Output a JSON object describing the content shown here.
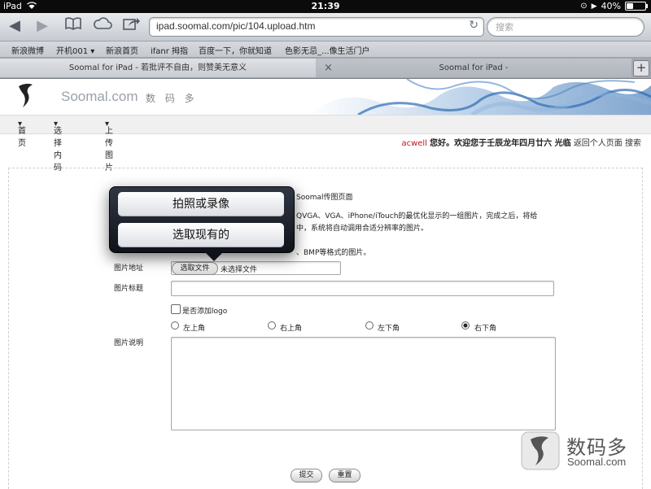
{
  "status_bar": {
    "device": "iPad",
    "time": "21:39",
    "battery": "40%",
    "battery_level": 0.4
  },
  "browser": {
    "url": "ipad.soomal.com/pic/104.upload.htm",
    "search_placeholder": "搜索",
    "bookmarks": [
      "新浪微博",
      "开机001 ▾",
      "新浪首页",
      "ifanr 拇指",
      "百度一下，你就知道",
      "色影无忌_...像生活门户"
    ],
    "tabs": [
      {
        "title": "Soomal for iPad - 若批评不自由，则赞美无意义"
      },
      {
        "title": "Soomal for iPad -"
      }
    ],
    "new_tab": "+",
    "close_tab": "×"
  },
  "site": {
    "brand": "Soomal.com",
    "brand_cn": "数 码 多",
    "nav": [
      {
        "label": "首页"
      },
      {
        "label": "选择内码"
      },
      {
        "label": "上传图片"
      }
    ],
    "welcome": {
      "user": "acwell",
      "message": "您好。欢迎您于壬辰龙年四月廿六 光临",
      "links": "返回个人页面 搜索"
    }
  },
  "form": {
    "intro_title": "Soomal传图页面",
    "intro_line1": "QVGA、VGA、iPhone/iTouch的最优化显示的一组图片，完成之后，将给",
    "intro_line2": "中，系统将自动调用合适分辨率的图片。",
    "intro_line3": "、BMP等格式的图片。",
    "image_address_label": "图片地址",
    "choose_file": "选取文件",
    "no_file": "未选择文件",
    "image_title_label": "图片标题",
    "add_logo_label": "是否添加logo",
    "positions": [
      {
        "label": "左上角",
        "checked": false
      },
      {
        "label": "右上角",
        "checked": false
      },
      {
        "label": "左下角",
        "checked": false
      },
      {
        "label": "右下角",
        "checked": true
      }
    ],
    "description_label": "图片说明",
    "submit": "提交",
    "reset": "重置"
  },
  "popover": {
    "items": [
      "拍照或录像",
      "选取现有的"
    ]
  },
  "watermark": {
    "cn": "数码多",
    "en": "Soomal.com"
  }
}
